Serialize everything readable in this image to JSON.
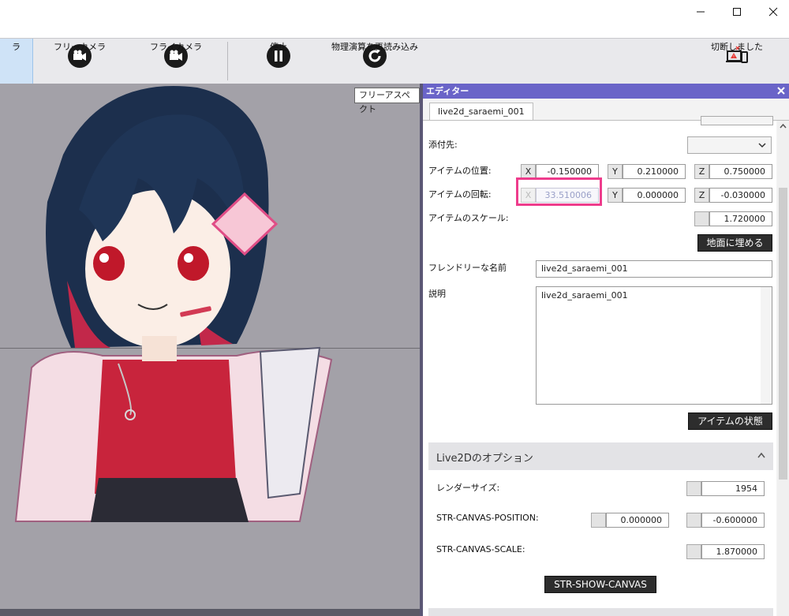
{
  "window": {
    "controls": [
      "minimize",
      "maximize",
      "close"
    ]
  },
  "toolbar": {
    "items": [
      {
        "label": "ラ",
        "icon": "camera-icon",
        "active": true
      },
      {
        "label": "フリーカメラ",
        "icon": "camera-icon"
      },
      {
        "label": "フライカメラ",
        "icon": "camera-icon"
      },
      {
        "label": "停止",
        "icon": "pause-icon"
      },
      {
        "label": "物理演算を再読み込み",
        "icon": "reload-icon"
      },
      {
        "label": "切断しました",
        "icon": "disconnected-device-icon"
      }
    ]
  },
  "viewport": {
    "aspect_label": "フリーアスペクト"
  },
  "editor": {
    "title": "エディター",
    "tab": "live2d_saraemi_001",
    "attach_label": "添付先:",
    "position": {
      "label": "アイテムの位置:",
      "x": "-0.150000",
      "y": "0.210000",
      "z": "0.750000"
    },
    "rotation": {
      "label": "アイテムの回転:",
      "x": "33.510006",
      "y": "0.000000",
      "z": "-0.030000"
    },
    "scale": {
      "label": "アイテムのスケール:",
      "value": "1.720000"
    },
    "ground_button": "地面に埋める",
    "friendly_name": {
      "label": "フレンドリーな名前",
      "value": "live2d_saraemi_001"
    },
    "description": {
      "label": "説明",
      "value": "live2d_saraemi_001"
    },
    "state_button": "アイテムの状態",
    "axes": {
      "x": "X",
      "y": "Y",
      "z": "Z"
    }
  },
  "live2d_options": {
    "title": "Live2Dのオプション",
    "render_size": {
      "label": "レンダーサイズ:",
      "value": "1954"
    },
    "canvas_position": {
      "label": "STR-CANVAS-POSITION:",
      "x": "0.000000",
      "y": "-0.600000"
    },
    "canvas_scale": {
      "label": "STR-CANVAS-SCALE:",
      "value": "1.870000"
    },
    "show_canvas_button": "STR-SHOW-CANVAS"
  },
  "colors": {
    "editor_title_bar": "#6a64c8",
    "highlight_box": "#ee3c8c",
    "viewport_bg": "#a3a1a8",
    "dark_button": "#2d2d2d"
  }
}
